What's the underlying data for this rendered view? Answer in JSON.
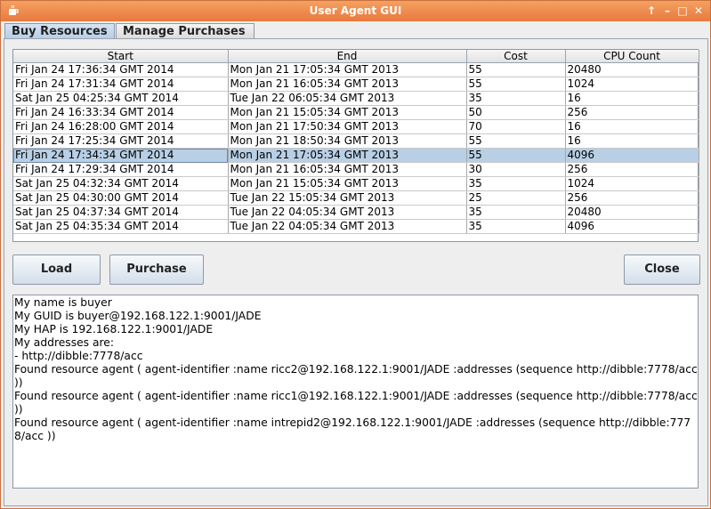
{
  "window": {
    "title": "User Agent GUI"
  },
  "tabs": [
    {
      "label": "Buy Resources",
      "active": true
    },
    {
      "label": "Manage Purchases",
      "active": false
    }
  ],
  "table": {
    "columns": [
      "Start",
      "End",
      "Cost",
      "CPU Count"
    ],
    "rows": [
      [
        "Fri Jan 24 17:36:34 GMT 2014",
        "Mon Jan 21 17:05:34 GMT 2013",
        "55",
        "20480"
      ],
      [
        "Fri Jan 24 17:31:34 GMT 2014",
        "Mon Jan 21 16:05:34 GMT 2013",
        "55",
        "1024"
      ],
      [
        "Sat Jan 25 04:25:34 GMT 2014",
        "Tue Jan 22 06:05:34 GMT 2013",
        "35",
        "16"
      ],
      [
        "Fri Jan 24 16:33:34 GMT 2014",
        "Mon Jan 21 15:05:34 GMT 2013",
        "50",
        "256"
      ],
      [
        "Fri Jan 24 16:28:00 GMT 2014",
        "Mon Jan 21 17:50:34 GMT 2013",
        "70",
        "16"
      ],
      [
        "Fri Jan 24 17:25:34 GMT 2014",
        "Mon Jan 21 18:50:34 GMT 2013",
        "55",
        "16"
      ],
      [
        "Fri Jan 24 17:34:34 GMT 2014",
        "Mon Jan 21 17:05:34 GMT 2013",
        "55",
        "4096"
      ],
      [
        "Fri Jan 24 17:29:34 GMT 2014",
        "Mon Jan 21 16:05:34 GMT 2013",
        "30",
        "256"
      ],
      [
        "Sat Jan 25 04:32:34 GMT 2014",
        "Mon Jan 21 15:05:34 GMT 2013",
        "35",
        "1024"
      ],
      [
        "Sat Jan 25 04:30:00 GMT 2014",
        "Tue Jan 22 15:05:34 GMT 2013",
        "25",
        "256"
      ],
      [
        "Sat Jan 25 04:37:34 GMT 2014",
        "Tue Jan 22 04:05:34 GMT 2013",
        "35",
        "20480"
      ],
      [
        "Sat Jan 25 04:35:34 GMT 2014",
        "Tue Jan 22 04:05:34 GMT 2013",
        "35",
        "4096"
      ]
    ],
    "selected_row": 6
  },
  "buttons": {
    "load": "Load",
    "purchase": "Purchase",
    "close": "Close"
  },
  "log": [
    "My name is buyer",
    "My GUID is buyer@192.168.122.1:9001/JADE",
    "My HAP is 192.168.122.1:9001/JADE",
    "My addresses are:",
    "- http://dibble:7778/acc",
    "Found resource agent ( agent-identifier :name ricc2@192.168.122.1:9001/JADE  :addresses (sequence http://dibble:7778/acc ))",
    "Found resource agent ( agent-identifier :name ricc1@192.168.122.1:9001/JADE  :addresses (sequence http://dibble:7778/acc ))",
    "Found resource agent ( agent-identifier :name intrepid2@192.168.122.1:9001/JADE  :addresses (sequence http://dibble:7778/acc ))"
  ],
  "icons": {
    "app": "java-cup-icon",
    "up": "arrow-up-icon",
    "min": "minimize-icon",
    "max": "maximize-icon",
    "close": "close-icon"
  },
  "colors": {
    "titlebar": "#e8793e",
    "selection": "#b8cfe5"
  }
}
